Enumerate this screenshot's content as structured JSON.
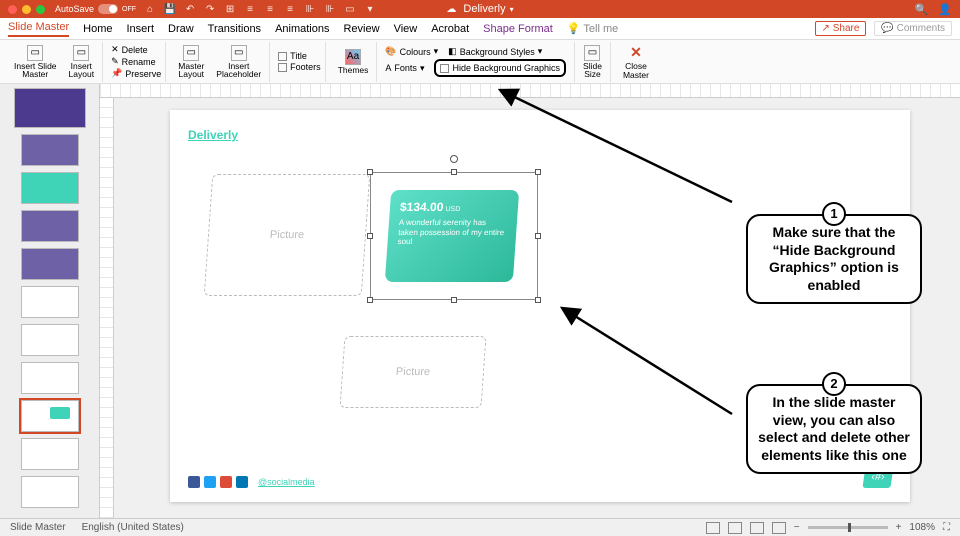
{
  "titlebar": {
    "autosave_label": "AutoSave",
    "autosave_state": "OFF",
    "filename": "Deliverly"
  },
  "tabs": {
    "items": [
      "Slide Master",
      "Home",
      "Insert",
      "Draw",
      "Transitions",
      "Animations",
      "Review",
      "View",
      "Acrobat",
      "Shape Format"
    ],
    "tellme": "Tell me",
    "share": "Share",
    "comments": "Comments"
  },
  "ribbon": {
    "insert_slide_master": "Insert Slide\nMaster",
    "insert_layout": "Insert\nLayout",
    "delete": "Delete",
    "rename": "Rename",
    "preserve": "Preserve",
    "master_layout": "Master\nLayout",
    "insert_placeholder": "Insert\nPlaceholder",
    "title": "Title",
    "footers": "Footers",
    "themes": "Themes",
    "colours": "Colours",
    "fonts": "Fonts",
    "background_styles": "Background Styles",
    "hide_bg": "Hide Background Graphics",
    "slide_size": "Slide\nSize",
    "close_master": "Close\nMaster"
  },
  "slide": {
    "logo": "Deliverly",
    "picture_placeholder": "Picture",
    "price": "$134.00",
    "currency": "USD",
    "price_desc": "A wonderful serenity has taken possession of my entire soul",
    "social_handle": "@socialmedia"
  },
  "annotations": {
    "step1": "1",
    "step1_text": "Make sure that the “Hide Background Graphics” option is enabled",
    "step2": "2",
    "step2_text": "In the slide master view, you can also select and delete other elements like this one"
  },
  "status": {
    "mode": "Slide Master",
    "lang": "English (United States)",
    "zoom": "108%"
  }
}
